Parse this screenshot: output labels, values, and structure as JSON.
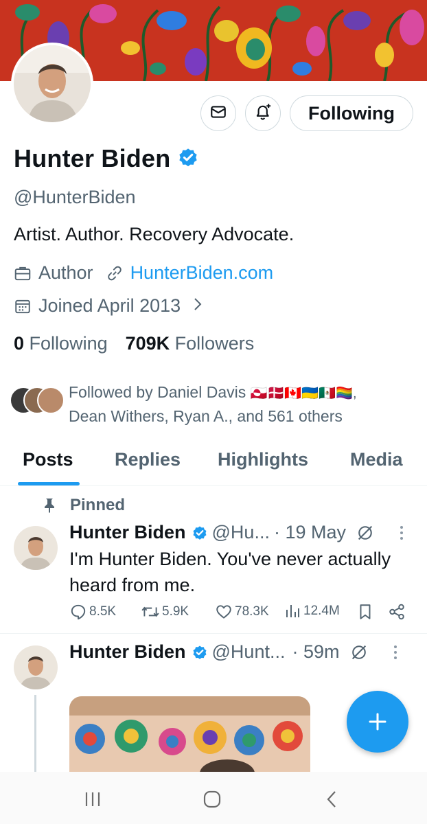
{
  "profile": {
    "display_name": "Hunter Biden",
    "handle": "@HunterBiden",
    "bio": "Artist. Author. Recovery Advocate.",
    "category": "Author",
    "website": "HunterBiden.com",
    "joined": "Joined April 2013",
    "following_count": "0",
    "following_label": "Following",
    "followers_count": "709K",
    "followers_label": "Followers",
    "followed_by_line1": "Followed by Daniel Davis",
    "followed_by_flags": "🇬🇱🇩🇰🇨🇦🇺🇦🇲🇽🏳️‍🌈,",
    "followed_by_line2": "Dean Withers, Ryan A., and 561 others"
  },
  "actions": {
    "follow_label": "Following",
    "message_icon": "mail-icon",
    "notify_icon": "bell-plus-icon"
  },
  "tabs": [
    {
      "label": "Posts",
      "active": true
    },
    {
      "label": "Replies",
      "active": false
    },
    {
      "label": "Highlights",
      "active": false
    },
    {
      "label": "Media",
      "active": false
    }
  ],
  "posts": [
    {
      "pinned_label": "Pinned",
      "name": "Hunter Biden",
      "handle": "@Hu...",
      "time": "· 19 May",
      "text": "I'm Hunter Biden. You've never actually heard from me.",
      "replies": "8.5K",
      "reposts": "5.9K",
      "likes": "78.3K",
      "views": "12.4M"
    },
    {
      "name": "Hunter Biden",
      "handle": "@Hunt...",
      "time": "· 59m"
    }
  ],
  "colors": {
    "accent": "#1d9bf0",
    "text_primary": "#0f1419",
    "text_secondary": "#536471",
    "banner": "#c8331f"
  }
}
